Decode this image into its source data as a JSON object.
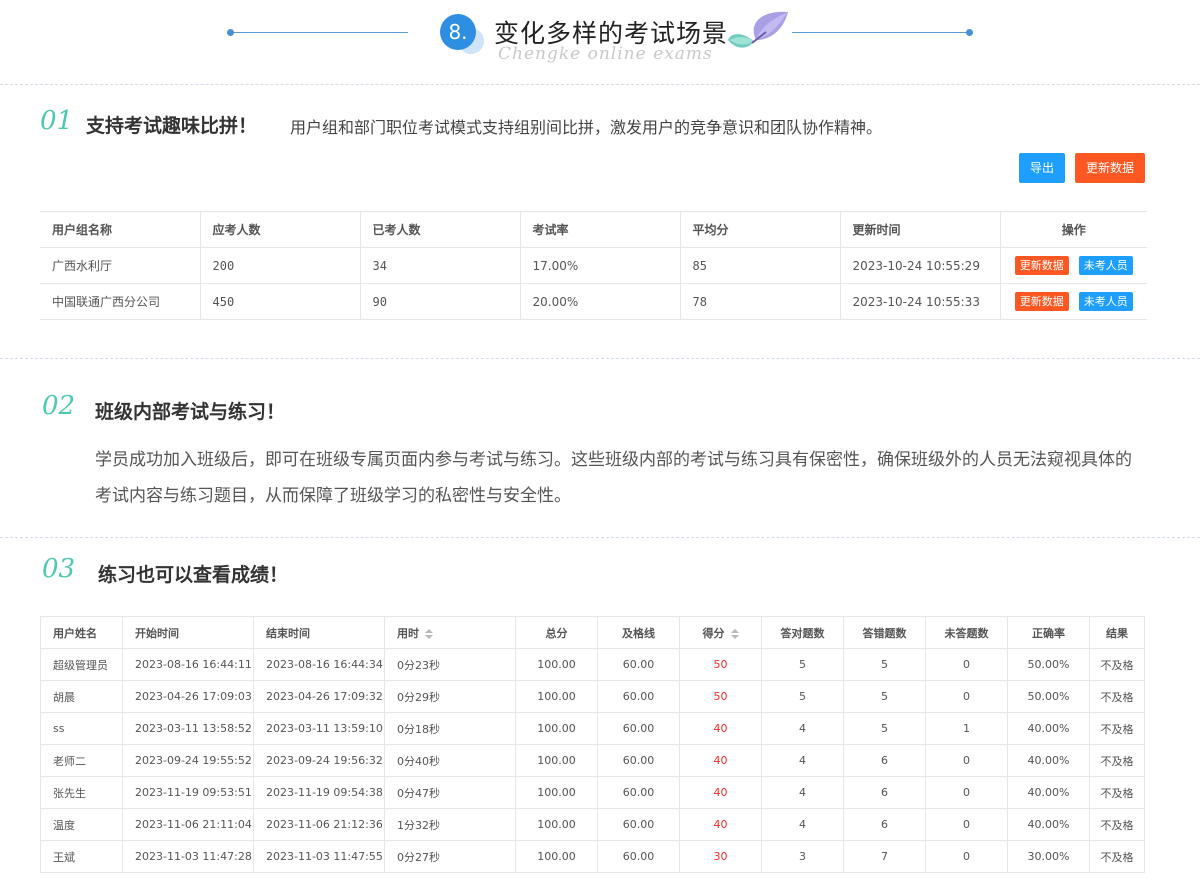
{
  "header": {
    "number": "8.",
    "title": "变化多样的考试场景",
    "subtitle": "Chengke online exams"
  },
  "sec1": {
    "num": "01",
    "title": "支持考试趣味比拼！",
    "desc": "用户组和部门职位考试模式支持组别间比拼，激发用户的竞争意识和团队协作精神。",
    "export_btn": "导出",
    "update_btn": "更新数据",
    "columns": [
      "用户组名称",
      "应考人数",
      "已考人数",
      "考试率",
      "平均分",
      "更新时间",
      "操作"
    ],
    "rows": [
      {
        "name": "广西水利厅",
        "expected": "200",
        "taken": "34",
        "rate": "17.00%",
        "avg": "85",
        "time": "2023-10-24 10:55:29",
        "op1": "更新数据",
        "op2": "未考人员"
      },
      {
        "name": "中国联通广西分公司",
        "expected": "450",
        "taken": "90",
        "rate": "20.00%",
        "avg": "78",
        "time": "2023-10-24 10:55:33",
        "op1": "更新数据",
        "op2": "未考人员"
      }
    ]
  },
  "sec2": {
    "num": "02",
    "title": "班级内部考试与练习！",
    "para": "学员成功加入班级后，即可在班级专属页面内参与考试与练习。这些班级内部的考试与练习具有保密性，确保班级外的人员无法窥视具体的考试内容与练习题目，从而保障了班级学习的私密性与安全性。"
  },
  "sec3": {
    "num": "03",
    "title": "练习也可以查看成绩！",
    "columns": [
      "用户姓名",
      "开始时间",
      "结束时间",
      "用时",
      "总分",
      "及格线",
      "得分",
      "答对题数",
      "答错题数",
      "未答题数",
      "正确率",
      "结果"
    ],
    "rows": [
      [
        "超级管理员",
        "2023-08-16 16:44:11",
        "2023-08-16 16:44:34",
        "0分23秒",
        "100.00",
        "60.00",
        "50",
        "5",
        "5",
        "0",
        "50.00%",
        "不及格"
      ],
      [
        "胡晨",
        "2023-04-26 17:09:03",
        "2023-04-26 17:09:32",
        "0分29秒",
        "100.00",
        "60.00",
        "50",
        "5",
        "5",
        "0",
        "50.00%",
        "不及格"
      ],
      [
        "ss",
        "2023-03-11 13:58:52",
        "2023-03-11 13:59:10",
        "0分18秒",
        "100.00",
        "60.00",
        "40",
        "4",
        "5",
        "1",
        "40.00%",
        "不及格"
      ],
      [
        "老师二",
        "2023-09-24 19:55:52",
        "2023-09-24 19:56:32",
        "0分40秒",
        "100.00",
        "60.00",
        "40",
        "4",
        "6",
        "0",
        "40.00%",
        "不及格"
      ],
      [
        "张先生",
        "2023-11-19 09:53:51",
        "2023-11-19 09:54:38",
        "0分47秒",
        "100.00",
        "60.00",
        "40",
        "4",
        "6",
        "0",
        "40.00%",
        "不及格"
      ],
      [
        "温度",
        "2023-11-06 21:11:04",
        "2023-11-06 21:12:36",
        "1分32秒",
        "100.00",
        "60.00",
        "40",
        "4",
        "6",
        "0",
        "40.00%",
        "不及格"
      ],
      [
        "王斌",
        "2023-11-03 11:47:28",
        "2023-11-03 11:47:55",
        "0分27秒",
        "100.00",
        "60.00",
        "30",
        "3",
        "7",
        "0",
        "30.00%",
        "不及格"
      ]
    ]
  },
  "colors": {
    "accent_blue": "#1e9fff",
    "accent_orange": "#ff5722",
    "section_num": "#4cc9b0",
    "score_red": "#ff2a2a"
  }
}
